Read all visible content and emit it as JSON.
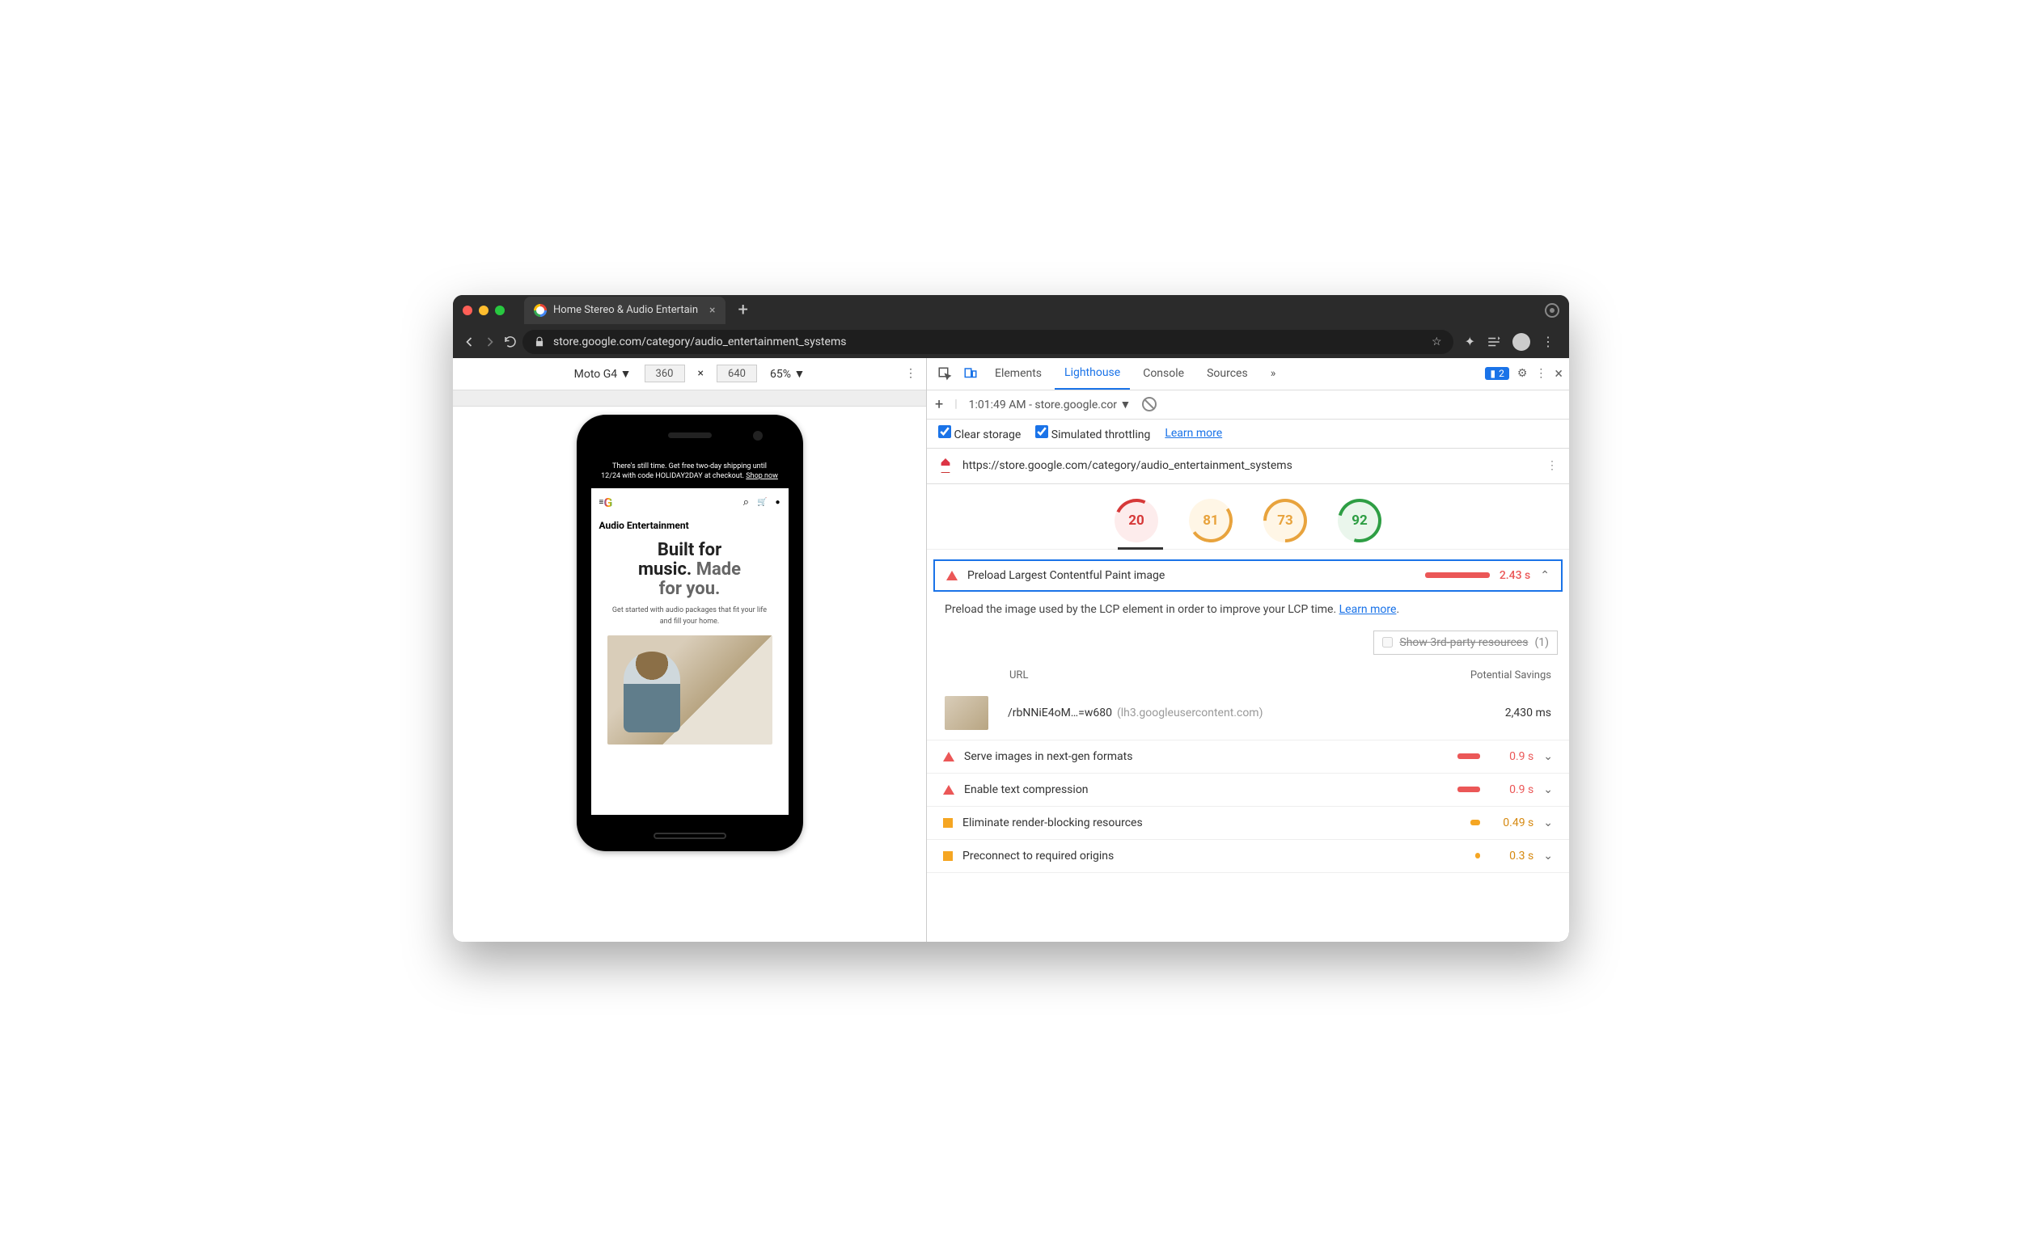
{
  "browser": {
    "tab_title": "Home Stereo & Audio Entertain",
    "url_display": "store.google.com/category/audio_entertainment_systems"
  },
  "device_toolbar": {
    "device": "Moto G4",
    "width": "360",
    "height": "640",
    "zoom": "65%"
  },
  "phone_page": {
    "banner_line1": "There's still time. Get free two-day shipping until",
    "banner_line2": "12/24 with code HOLIDAY2DAY at checkout.",
    "banner_link": "Shop now",
    "g": "G",
    "section_title": "Audio Entertainment",
    "hero_1a": "Built for",
    "hero_1b": "music.",
    "hero_2a": "Made",
    "hero_2b": "for you.",
    "sub": "Get started with audio packages that fit your life and fill your home."
  },
  "devtools": {
    "tabs": {
      "elements": "Elements",
      "lighthouse": "Lighthouse",
      "console": "Console",
      "sources": "Sources",
      "more": "»"
    },
    "issue_count": "2",
    "run_label": "1:01:49 AM - store.google.cor",
    "clear_storage": "Clear storage",
    "simulated": "Simulated throttling",
    "learn_more": "Learn more",
    "audited_url": "https://store.google.com/category/audio_entertainment_systems"
  },
  "scores": {
    "s1": "20",
    "s2": "81",
    "s3": "73",
    "s4": "92"
  },
  "main_audit": {
    "title": "Preload Largest Contentful Paint image",
    "value": "2.43 s",
    "description": "Preload the image used by the LCP element in order to improve your LCP time. ",
    "learn": "Learn more",
    "third_party_label": "Show 3rd-party resources",
    "third_party_count": "(1)",
    "col_url": "URL",
    "col_savings": "Potential Savings",
    "row_url": "/rbNNiE4oM…=w680",
    "row_host": "(lh3.googleusercontent.com)",
    "row_savings": "2,430 ms"
  },
  "audits": [
    {
      "icon": "tri",
      "title": "Serve images in next-gen formats",
      "bar": "sbar",
      "value": "0.9 s",
      "cls": ""
    },
    {
      "icon": "tri",
      "title": "Enable text compression",
      "bar": "sbar",
      "value": "0.9 s",
      "cls": ""
    },
    {
      "icon": "sq",
      "title": "Eliminate render-blocking resources",
      "bar": "sbar sm",
      "value": "0.49 s",
      "cls": "or"
    },
    {
      "icon": "sq",
      "title": "Preconnect to required origins",
      "bar": "sbar xs",
      "value": "0.3 s",
      "cls": "or"
    }
  ]
}
